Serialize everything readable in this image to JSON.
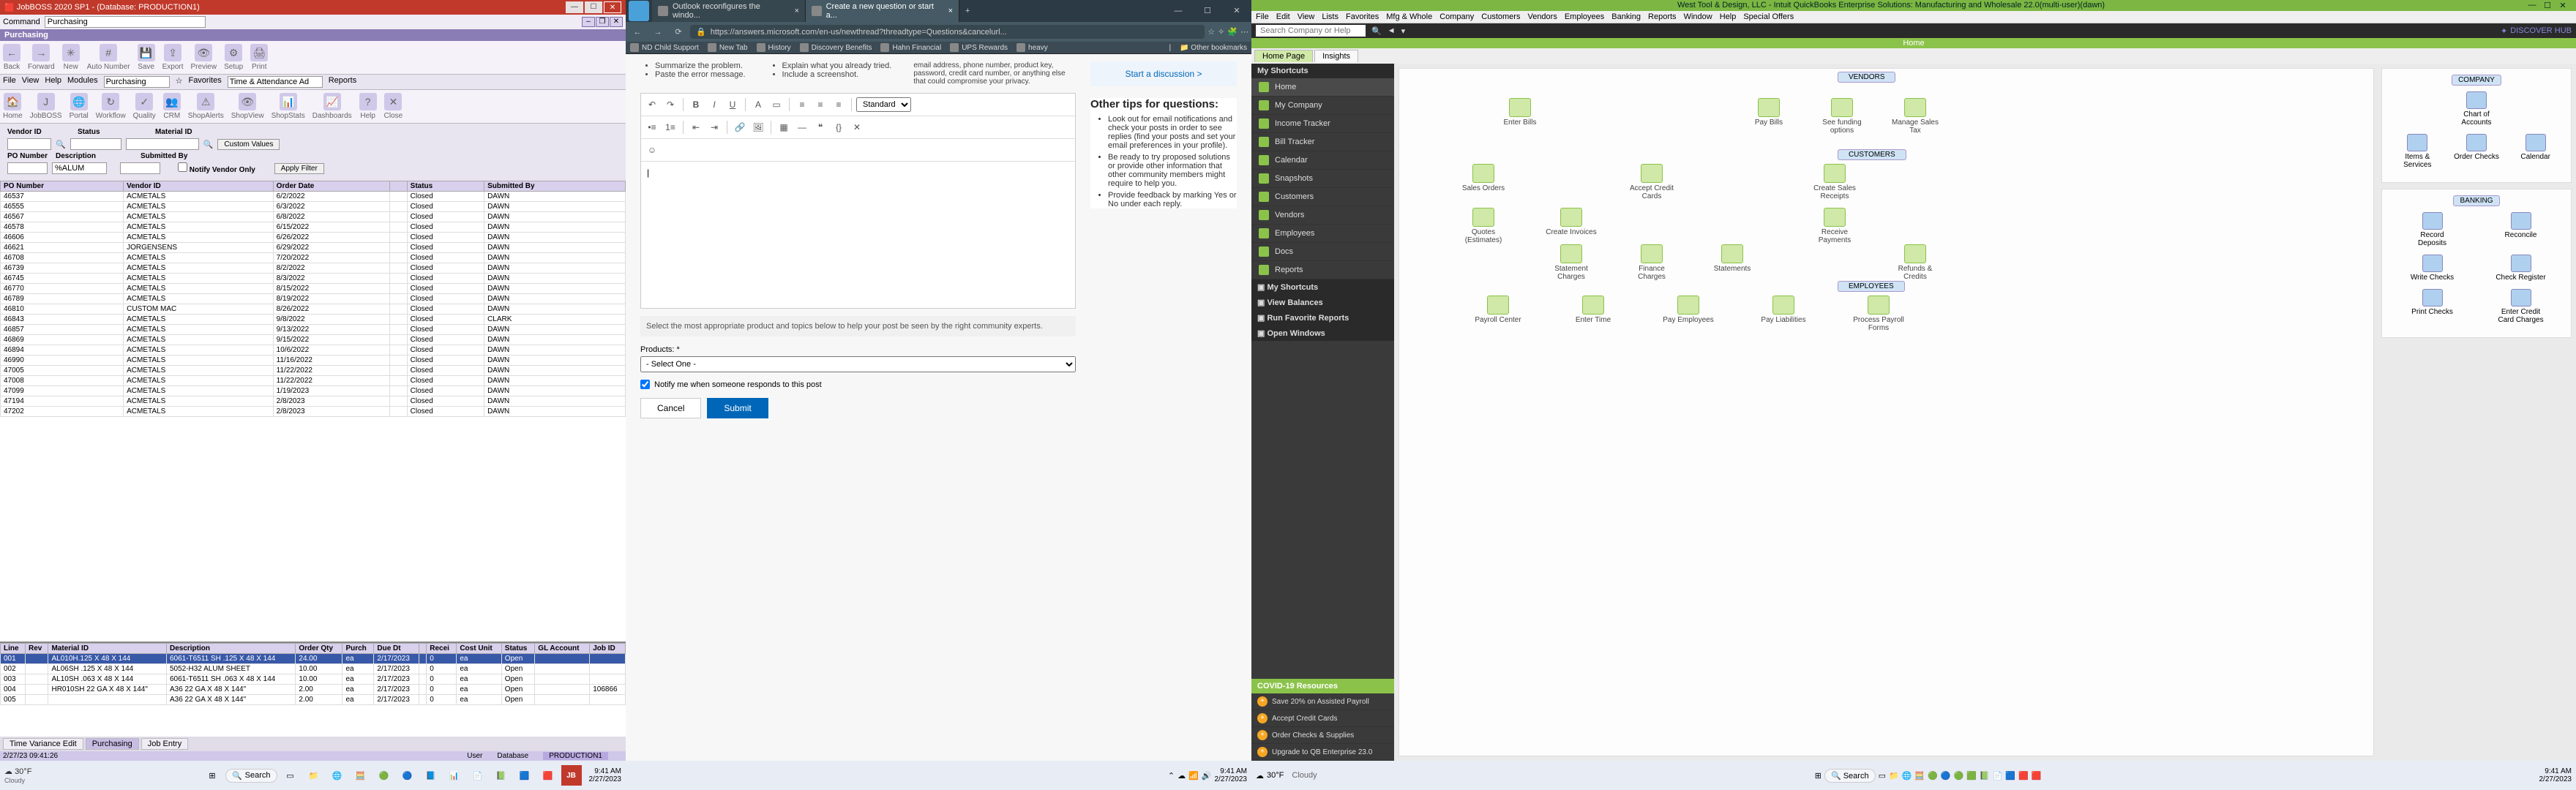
{
  "jobboss": {
    "title": "JobBOSS 2020 SP1 - (Database: PRODUCTION1)",
    "command_label": "Command",
    "command_value": "Purchasing",
    "subtitle": "Purchasing",
    "ribbon": [
      {
        "label": "Back",
        "icon": "←"
      },
      {
        "label": "Forward",
        "icon": "→"
      },
      {
        "label": "New",
        "icon": "✳"
      },
      {
        "label": "Auto Number",
        "icon": "#"
      },
      {
        "label": "Save",
        "icon": "💾"
      },
      {
        "label": "Export",
        "icon": "⇪"
      },
      {
        "label": "Preview",
        "icon": "👁"
      },
      {
        "label": "Setup",
        "icon": "⚙"
      },
      {
        "label": "Print",
        "icon": "🖨"
      }
    ],
    "ribbon2": [
      {
        "label": "Home",
        "icon": "🏠"
      },
      {
        "label": "JobBOSS",
        "icon": "J"
      },
      {
        "label": "Portal",
        "icon": "🌐"
      },
      {
        "label": "Workflow",
        "icon": "↻"
      },
      {
        "label": "Quality",
        "icon": "✓"
      },
      {
        "label": "CRM",
        "icon": "👥"
      },
      {
        "label": "ShopAlerts",
        "icon": "⚠"
      },
      {
        "label": "ShopView",
        "icon": "👁"
      },
      {
        "label": "ShopStats",
        "icon": "📊"
      },
      {
        "label": "Dashboards",
        "icon": "📈"
      },
      {
        "label": "Help",
        "icon": "?"
      },
      {
        "label": "Close",
        "icon": "✕"
      }
    ],
    "tabbar": {
      "file": "File",
      "view": "View",
      "help": "Help",
      "modules": "Modules",
      "modules_value": "Purchasing",
      "fav": "Favorites",
      "fav_value": "Time & Attendance Ad",
      "reports": "Reports"
    },
    "form": {
      "vendor_id_label": "Vendor ID",
      "status_label": "Status",
      "material_id_label": "Material ID",
      "custom_values": "Custom Values",
      "po_number_label": "PO Number",
      "description_label": "Description",
      "submitted_by_label": "Submitted By",
      "desc_value": "%ALUM",
      "notify": "Notify Vendor Only",
      "apply": "Apply Filter"
    },
    "grid_headers": [
      "PO Number",
      "Vendor ID",
      "Order Date",
      "",
      "Status",
      "Submitted By"
    ],
    "grid_rows": [
      [
        "46537",
        "ACMETALS",
        "6/2/2022",
        "",
        "Closed",
        "DAWN"
      ],
      [
        "46555",
        "ACMETALS",
        "6/3/2022",
        "",
        "Closed",
        "DAWN"
      ],
      [
        "46567",
        "ACMETALS",
        "6/8/2022",
        "",
        "Closed",
        "DAWN"
      ],
      [
        "46578",
        "ACMETALS",
        "6/15/2022",
        "",
        "Closed",
        "DAWN"
      ],
      [
        "46606",
        "ACMETALS",
        "6/26/2022",
        "",
        "Closed",
        "DAWN"
      ],
      [
        "46621",
        "JORGENSENS",
        "6/29/2022",
        "",
        "Closed",
        "DAWN"
      ],
      [
        "46708",
        "ACMETALS",
        "7/20/2022",
        "",
        "Closed",
        "DAWN"
      ],
      [
        "46739",
        "ACMETALS",
        "8/2/2022",
        "",
        "Closed",
        "DAWN"
      ],
      [
        "46745",
        "ACMETALS",
        "8/3/2022",
        "",
        "Closed",
        "DAWN"
      ],
      [
        "46770",
        "ACMETALS",
        "8/15/2022",
        "",
        "Closed",
        "DAWN"
      ],
      [
        "46789",
        "ACMETALS",
        "8/19/2022",
        "",
        "Closed",
        "DAWN"
      ],
      [
        "46810",
        "CUSTOM MAC",
        "8/26/2022",
        "",
        "Closed",
        "DAWN"
      ],
      [
        "46843",
        "ACMETALS",
        "9/8/2022",
        "",
        "Closed",
        "CLARK"
      ],
      [
        "46857",
        "ACMETALS",
        "9/13/2022",
        "",
        "Closed",
        "DAWN"
      ],
      [
        "46869",
        "ACMETALS",
        "9/15/2022",
        "",
        "Closed",
        "DAWN"
      ],
      [
        "46894",
        "ACMETALS",
        "10/6/2022",
        "",
        "Closed",
        "DAWN"
      ],
      [
        "46990",
        "ACMETALS",
        "11/16/2022",
        "",
        "Closed",
        "DAWN"
      ],
      [
        "47005",
        "ACMETALS",
        "11/22/2022",
        "",
        "Closed",
        "DAWN"
      ],
      [
        "47008",
        "ACMETALS",
        "11/22/2022",
        "",
        "Closed",
        "DAWN"
      ],
      [
        "47099",
        "ACMETALS",
        "1/19/2023",
        "",
        "Closed",
        "DAWN"
      ],
      [
        "47194",
        "ACMETALS",
        "2/8/2023",
        "",
        "Closed",
        "DAWN"
      ],
      [
        "47202",
        "ACMETALS",
        "2/8/2023",
        "",
        "Closed",
        "DAWN"
      ]
    ],
    "grid2_headers": [
      "Line",
      "Rev",
      "Material ID",
      "Description",
      "Order Qty",
      "Purch",
      "Due Dt",
      "",
      "Recei",
      "Cost Unit",
      "Status",
      "GL Account",
      "Job ID"
    ],
    "grid2_rows": [
      [
        "001",
        "",
        "AL010H.125 X 48 X 144",
        "6061-T6511 SH .125 X 48 X 144",
        "24.00",
        "ea",
        "2/17/2023",
        "",
        "0",
        "ea",
        "Open",
        "",
        ""
      ],
      [
        "002",
        "",
        "AL06SH .125 X 48 X 144",
        "5052-H32 ALUM SHEET",
        "10.00",
        "ea",
        "2/17/2023",
        "",
        "0",
        "ea",
        "Open",
        "",
        ""
      ],
      [
        "003",
        "",
        "AL10SH .063 X 48 X 144",
        "6061-T6511 SH .063 X 48 X 144",
        "10.00",
        "ea",
        "2/17/2023",
        "",
        "0",
        "ea",
        "Open",
        "",
        ""
      ],
      [
        "004",
        "",
        "HR010SH 22 GA X 48 X 144\"",
        "A36 22 GA X 48 X 144\"",
        "2.00",
        "ea",
        "2/17/2023",
        "",
        "0",
        "ea",
        "Open",
        "",
        "106866"
      ],
      [
        "005",
        "",
        "",
        "A36 22 GA X 48 X 144\"",
        "2.00",
        "ea",
        "2/17/2023",
        "",
        "0",
        "ea",
        "Open",
        "",
        ""
      ]
    ],
    "bottom_tabs": [
      "Time Variance Edit",
      "Purchasing",
      "Job Entry"
    ],
    "status": {
      "time": "2/27/23 09:41:26",
      "user_label": "User",
      "db_label": "Database",
      "db": "PRODUCTION1"
    },
    "taskbar": {
      "weather": "30°F",
      "weather_sub": "Cloudy",
      "search": "Search",
      "time": "9:41 AM",
      "date": "2/27/2023"
    }
  },
  "edge": {
    "tabs": [
      {
        "title": "Outlook reconfigures the windo..."
      },
      {
        "title": "Create a new question or start a..."
      }
    ],
    "url": "https://answers.microsoft.com/en-us/newthread?threadtype=Questions&cancelurl...",
    "bookmarks": [
      "ND Child Support",
      "New Tab",
      "History",
      "Discovery Benefits",
      "Hahn Financial",
      "UPS Rewards",
      "heavy"
    ],
    "bookmarks_more": "Other bookmarks",
    "tips_existing": [
      "Summarize the problem.",
      "Paste the error message.",
      "Explain what you already tried.",
      "Include a screenshot.",
      "email address, phone number, product key, password, credit card number, or anything else that could compromise your privacy."
    ],
    "cta": "Start a discussion >",
    "tips_title": "Other tips for questions:",
    "tips": [
      "Look out for email notifications and check your posts in order to see replies (find your posts and set your email preferences in your profile).",
      "Be ready to try proposed solutions or provide other information that other community members might require to help you.",
      "Provide feedback by marking Yes or No under each reply."
    ],
    "toolbar_style": "Standard",
    "note": "Select the most appropriate product and topics below to help your post be seen by the right community experts.",
    "products_label": "Products: *",
    "products_placeholder": "- Select One -",
    "notify_label": "Notify me when someone responds to this post",
    "cancel": "Cancel",
    "submit": "Submit",
    "taskbar": {
      "time": "9:41 AM",
      "date": "2/27/2023"
    }
  },
  "quickbooks": {
    "title": "West Tool & Design, LLC - Intuit QuickBooks Enterprise Solutions: Manufacturing and Wholesale 22.0(multi-user)(dawn)",
    "menus": [
      "File",
      "Edit",
      "View",
      "Lists",
      "Favorites",
      "Mfg & Whole",
      "Company",
      "Customers",
      "Vendors",
      "Employees",
      "Banking",
      "Reports",
      "Window",
      "Help",
      "Special Offers"
    ],
    "search_placeholder": "Search Company or Help",
    "discover": "DISCOVER HUB",
    "home": "Home",
    "hometabs": [
      "Home Page",
      "Insights"
    ],
    "sidebar": {
      "header": "My Shortcuts",
      "items": [
        "Home",
        "My Company",
        "Income Tracker",
        "Bill Tracker",
        "Calendar",
        "Snapshots",
        "Customers",
        "Vendors",
        "Employees",
        "Docs",
        "Reports",
        "My Shortcuts",
        "View Balances",
        "Run Favorite Reports",
        "Open Windows"
      ],
      "covid": "COVID-19 Resources",
      "promos": [
        "Save 20% on Assisted Payroll",
        "Accept Credit Cards",
        "Order Checks & Supplies",
        "Upgrade to QB Enterprise 23.0"
      ]
    },
    "sections": {
      "vendors": "VENDORS",
      "customers": "CUSTOMERS",
      "employees": "EMPLOYEES",
      "company": "COMPANY",
      "banking": "BANKING"
    },
    "flow": {
      "vendors": [
        "Enter Bills",
        "Pay Bills",
        "See funding options",
        "Manage Sales Tax"
      ],
      "customers": [
        "Sales Orders",
        "Accept Credit Cards",
        "Create Sales Receipts",
        "Quotes (Estimates)",
        "Create Invoices",
        "Receive Payments",
        "Statement Charges",
        "Finance Charges",
        "Statements",
        "Refunds & Credits"
      ],
      "employees": [
        "Payroll Center",
        "Enter Time",
        "Pay Employees",
        "Pay Liabilities",
        "Process Payroll Forms"
      ]
    },
    "company": [
      "Chart of Accounts",
      "Items & Services",
      "Order Checks",
      "Calendar"
    ],
    "banking": [
      "Record Deposits",
      "Reconcile",
      "Write Checks",
      "Check Register",
      "Print Checks",
      "Enter Credit Card Charges"
    ],
    "taskbar": {
      "weather": "30°F",
      "weather_sub": "Cloudy",
      "search": "Search",
      "time": "9:41 AM",
      "date": "2/27/2023"
    }
  }
}
